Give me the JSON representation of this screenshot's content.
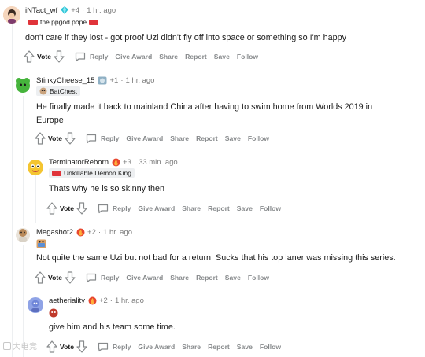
{
  "comments": [
    {
      "username": "iNTact_wf",
      "karma": "+4",
      "time": "1 hr. ago",
      "flair": "the ppgod pope",
      "text": "don't care if they lost - got proof Uzi didn't fly off into space or something so I'm happy",
      "vote_label": "Vote"
    },
    {
      "username": "StinkyCheese_15",
      "karma": "+1",
      "time": "1 hr. ago",
      "flair": "BatChest",
      "text": "He finally made it back to mainland China after having to swim home from Worlds 2019 in Europe",
      "vote_label": "Vote"
    },
    {
      "username": "TerminatorReborn",
      "karma": "+3",
      "time": "33 min. ago",
      "flair": "Unkillable Demon King",
      "text": "Thats why he is so skinny then",
      "vote_label": "Vote"
    },
    {
      "username": "Megashot2",
      "karma": "+2",
      "time": "1 hr. ago",
      "flair": "",
      "text": "Not quite the same Uzi but not bad for a return. Sucks that his top laner was missing this series.",
      "vote_label": "Vote"
    },
    {
      "username": "aetheriality",
      "karma": "+2",
      "time": "1 hr. ago",
      "flair": "",
      "text": "give him and his team some time.",
      "vote_label": "Vote"
    }
  ],
  "actions": {
    "reply": "Reply",
    "give_award": "Give Award",
    "share": "Share",
    "report": "Report",
    "save": "Save",
    "follow": "Follow"
  },
  "separator": "·",
  "watermark": "大电竞",
  "colors": {
    "text": "#1c1c1c",
    "meta": "#7c7c7c",
    "action": "#878a8c",
    "thread_line": "#edeff1",
    "flair_bg": "#edeff1"
  }
}
